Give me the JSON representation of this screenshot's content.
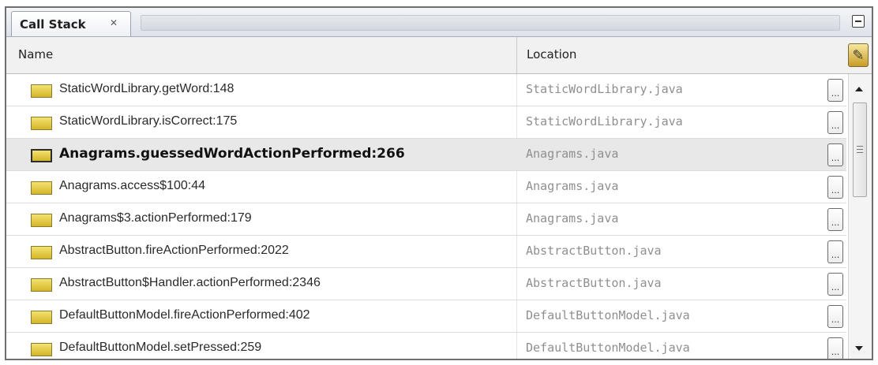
{
  "panel": {
    "tab_label": "Call Stack",
    "tab_close_icon": "close-tab-icon",
    "minimize_icon": "minimize-icon"
  },
  "columns": {
    "name": "Name",
    "location": "Location",
    "customize_icon": "column-chooser-icon"
  },
  "frames": [
    {
      "name": "StaticWordLibrary.getWord:148",
      "location": "StaticWordLibrary.java",
      "current": false
    },
    {
      "name": "StaticWordLibrary.isCorrect:175",
      "location": "StaticWordLibrary.java",
      "current": false
    },
    {
      "name": "Anagrams.guessedWordActionPerformed:266",
      "location": "Anagrams.java",
      "current": true
    },
    {
      "name": "Anagrams.access$100:44",
      "location": "Anagrams.java",
      "current": false
    },
    {
      "name": "Anagrams$3.actionPerformed:179",
      "location": "Anagrams.java",
      "current": false
    },
    {
      "name": "AbstractButton.fireActionPerformed:2022",
      "location": "AbstractButton.java",
      "current": false
    },
    {
      "name": "AbstractButton$Handler.actionPerformed:2346",
      "location": "AbstractButton.java",
      "current": false
    },
    {
      "name": "DefaultButtonModel.fireActionPerformed:402",
      "location": "DefaultButtonModel.java",
      "current": false
    },
    {
      "name": "DefaultButtonModel.setPressed:259",
      "location": "DefaultButtonModel.java",
      "current": false
    }
  ],
  "ellipsis_label": "...",
  "colors": {
    "frame_icon": "#e8d34a",
    "selected_row": "#e8e8e8",
    "location_text": "#8f8f8f"
  }
}
